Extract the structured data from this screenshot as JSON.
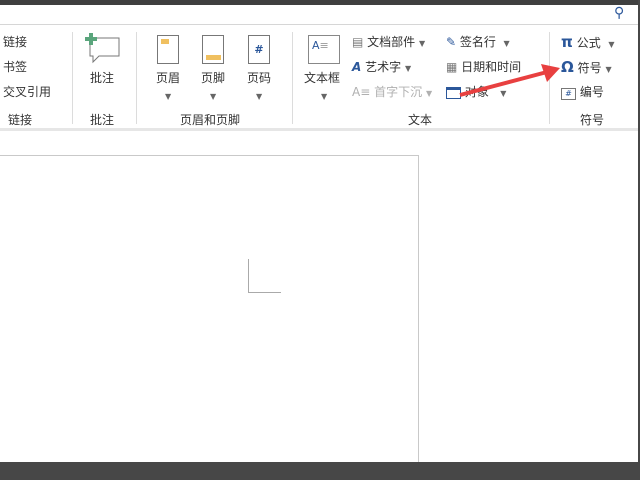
{
  "ribbon": {
    "links_group": {
      "items": [
        "链接",
        "书签",
        "交叉引用"
      ],
      "label": "链接"
    },
    "comment_group": {
      "button": "批注",
      "label": "批注"
    },
    "header_footer_group": {
      "buttons": [
        "页眉",
        "页脚",
        "页码"
      ],
      "label": "页眉和页脚"
    },
    "text_group": {
      "textbox": "文本框",
      "items_col1": [
        "文档部件",
        "艺术字",
        "首字下沉"
      ],
      "items_col2": [
        "签名行",
        "日期和时间",
        "对象"
      ],
      "label": "文本"
    },
    "symbols_group": {
      "items": [
        "公式",
        "符号",
        "编号"
      ],
      "label": "符号"
    }
  },
  "colors": {
    "accent": "#2b579a",
    "arrow": "#e84040",
    "icon_yellow": "#f0c060",
    "icon_green": "#5aa57c"
  }
}
